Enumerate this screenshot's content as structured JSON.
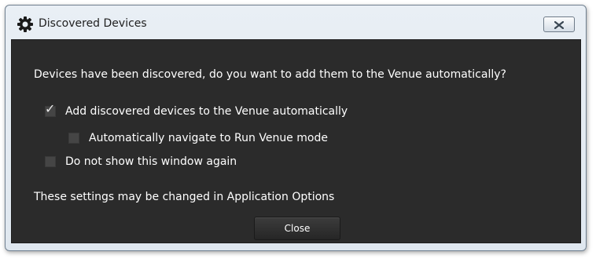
{
  "window": {
    "title": "Discovered Devices",
    "icon": "gear-icon",
    "close_icon": "close-icon"
  },
  "dialog": {
    "prompt": "Devices have been discovered, do you want to add them to the Venue automatically?",
    "options": [
      {
        "label": "Add discovered devices to the Venue automatically",
        "checked": true
      },
      {
        "label": "Automatically navigate to Run Venue mode",
        "checked": false
      },
      {
        "label": "Do not show this window again",
        "checked": false
      }
    ],
    "note": "These settings may be changed in Application Options",
    "close_label": "Close"
  },
  "colors": {
    "content_background": "#2b2b2b",
    "text": "#ffffff",
    "checkbox": "#454545",
    "titlebar": "#e4ebf2"
  }
}
